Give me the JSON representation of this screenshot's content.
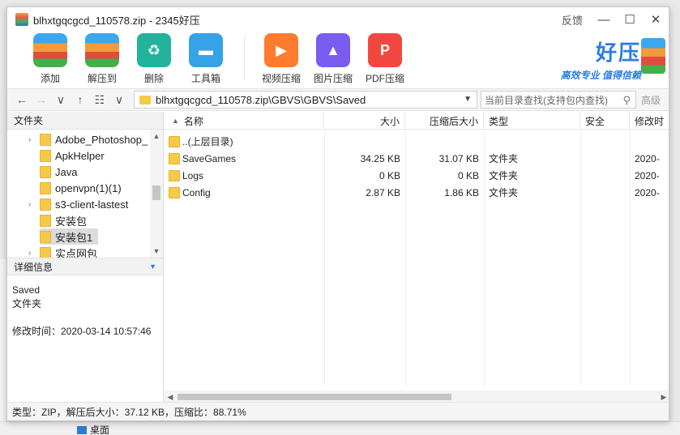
{
  "window": {
    "title": "blhxtgqcgcd_110578.zip - 2345好压",
    "feedback": "反馈",
    "minimize": "—",
    "maximize": "☐",
    "close": "✕"
  },
  "toolbar": {
    "tools": [
      {
        "label": "添加",
        "icon": "add-archive-icon"
      },
      {
        "label": "解压到",
        "icon": "extract-icon"
      },
      {
        "label": "删除",
        "icon": "recycle-delete-icon"
      },
      {
        "label": "工具箱",
        "icon": "toolbox-icon"
      },
      {
        "label": "视频压缩",
        "icon": "video-compress-icon"
      },
      {
        "label": "图片压缩",
        "icon": "image-compress-icon"
      },
      {
        "label": "PDF压缩",
        "icon": "pdf-compress-icon"
      }
    ],
    "brand_name": "好压",
    "brand_slogan": "高效专业  值得信赖"
  },
  "addressbar": {
    "back": "←",
    "forward": "→",
    "history": "∨",
    "up": "↑",
    "view": "☷",
    "view_dd": "∨",
    "path": "blhxtgqcgcd_110578.zip\\GBVS\\GBVS\\Saved",
    "search_placeholder": "当前目录查找(支持包内查找)",
    "advanced": "高级"
  },
  "sidebar": {
    "folders_header": "文件夹",
    "tree": [
      {
        "label": "Adobe_Photoshop_",
        "expandable": true
      },
      {
        "label": "ApkHelper",
        "expandable": false
      },
      {
        "label": "Java",
        "expandable": false
      },
      {
        "label": "openvpn(1)(1)",
        "expandable": false
      },
      {
        "label": "s3-client-lastest",
        "expandable": true
      },
      {
        "label": "安装包",
        "expandable": false
      },
      {
        "label": "安装包1",
        "expandable": false,
        "selected": true
      },
      {
        "label": "实点网包",
        "expandable": true
      }
    ],
    "details_header": "详细信息",
    "details": {
      "name": "Saved",
      "type": "文件夹",
      "modified": "修改时间：2020-03-14 10:57:46"
    }
  },
  "filelist": {
    "columns": {
      "name": "名称",
      "size": "大小",
      "compressed": "压缩后大小",
      "type": "类型",
      "security": "安全",
      "modified": "修改时"
    },
    "rows": [
      {
        "name": "..(上层目录)",
        "size": "",
        "compressed": "",
        "type": "",
        "modified": ""
      },
      {
        "name": "SaveGames",
        "size": "34.25 KB",
        "compressed": "31.07 KB",
        "type": "文件夹",
        "modified": "2020-"
      },
      {
        "name": "Logs",
        "size": "0 KB",
        "compressed": "0 KB",
        "type": "文件夹",
        "modified": "2020-"
      },
      {
        "name": "Config",
        "size": "2.87 KB",
        "compressed": "1.86 KB",
        "type": "文件夹",
        "modified": "2020-"
      }
    ]
  },
  "statusbar": {
    "text": "类型：ZIP，解压后大小：37.12 KB，压缩比：88.71%"
  },
  "background": {
    "desktop_label": "桌面"
  }
}
